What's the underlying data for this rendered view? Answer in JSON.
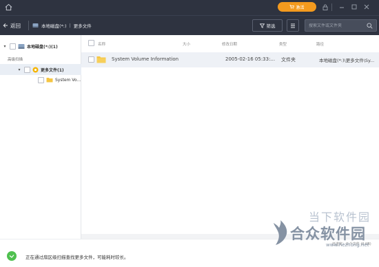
{
  "titlebar": {
    "activate_label": "激活",
    "colors": {
      "background": "#2e3340",
      "activate": "#f39a1e"
    },
    "icons": [
      "home-icon",
      "lock-icon",
      "separator",
      "minimize-icon",
      "restore-icon",
      "close-icon"
    ]
  },
  "toolbar": {
    "back_label": "返回",
    "breadcrumb": [
      "本地磁盘(*:)",
      "更多文件"
    ],
    "filter_label": "筛选",
    "search_placeholder": "搜索文件或文件夹"
  },
  "tree": {
    "root_label": "本地磁盘(*:)(1)",
    "scan_label": "高级扫描",
    "more_label": "更多文件(1)",
    "child_label": "System Vo..."
  },
  "table": {
    "headers": {
      "name": "名称",
      "size": "大小",
      "modified": "修改日期",
      "type": "类型",
      "path": "路径"
    },
    "rows": [
      {
        "name": "System Volume Information",
        "size": "",
        "modified": "2005-02-16 05:33:...",
        "type": "文件夹",
        "path": "本地磁盘(*:)\\更多文件\\Sy..."
      }
    ]
  },
  "status": {
    "message": "正在通过扇区级扫描查找更多文件，可能耗时较长。",
    "count": "已选定：0 个文件 (0 KB)"
  },
  "watermark": {
    "line1": "当下软件园",
    "line2": "合众软件园",
    "line3": "www.hezhong.net"
  }
}
